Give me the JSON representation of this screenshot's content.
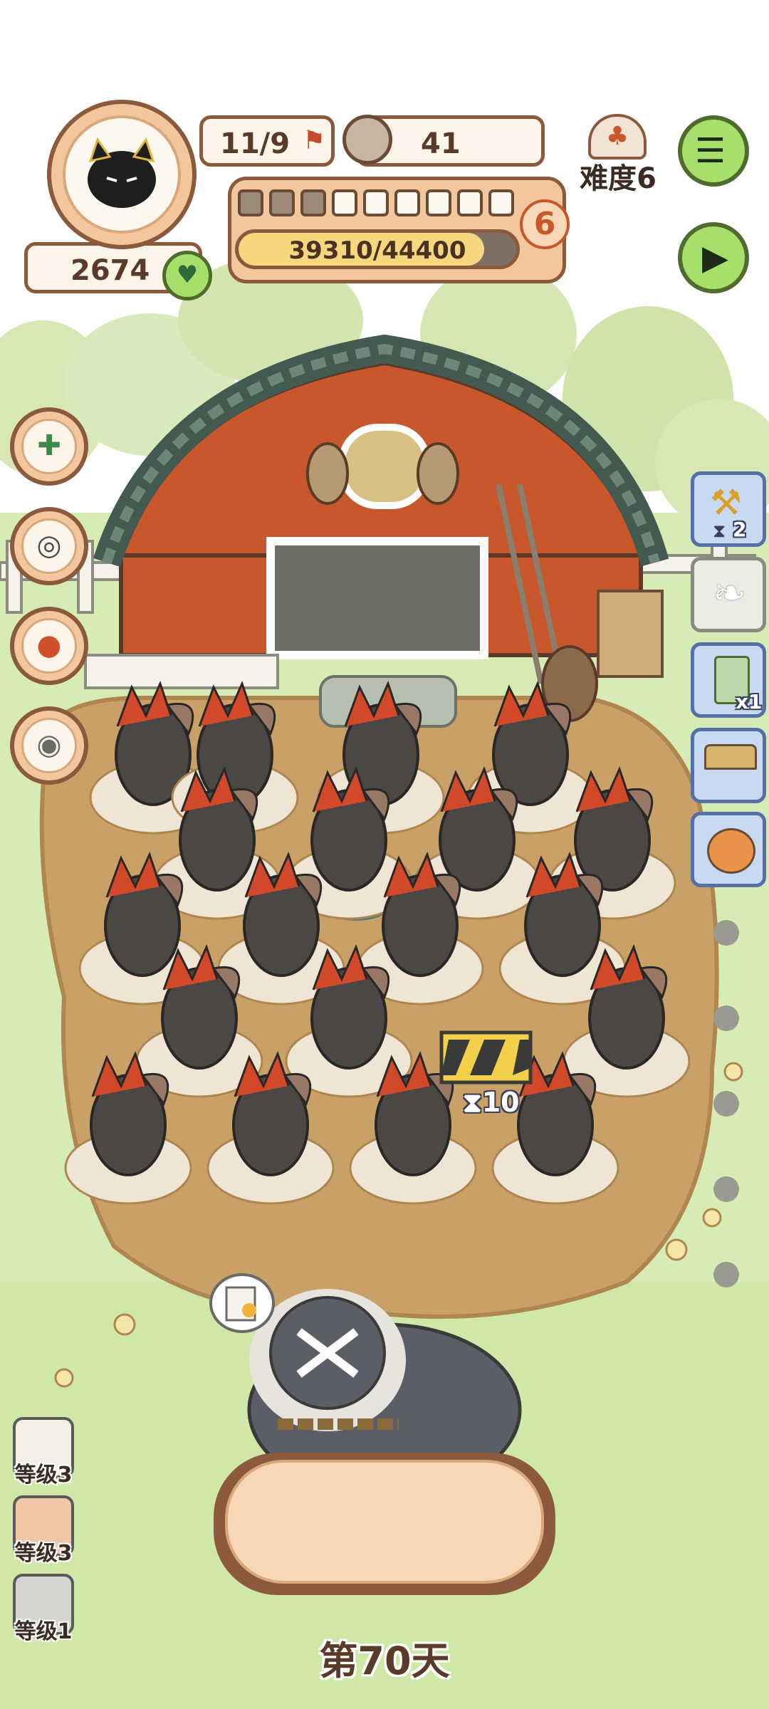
{
  "player": {
    "population": "11/9",
    "food": "41",
    "coins": "2674",
    "level": "6",
    "xp_text": "39310/44400",
    "xp_progress": 0.885,
    "segments_filled": 3,
    "segments_total": 9
  },
  "difficulty": {
    "label": "难度6"
  },
  "farm": {
    "build_timer": "10",
    "bird_count": 19
  },
  "items": [
    {
      "icon": "shovel-icon",
      "count": "2"
    },
    {
      "icon": "feather-icon",
      "count": ""
    },
    {
      "icon": "seed-packet-icon",
      "count": "x1"
    },
    {
      "icon": "straw-shelter-icon",
      "count": ""
    },
    {
      "icon": "fox-bed-icon",
      "count": ""
    }
  ],
  "side_buttons": [
    "medkit-icon",
    "collar-icon",
    "joystick-toy-icon",
    "food-bowl-icon"
  ],
  "level_cards": [
    {
      "label": "等级3"
    },
    {
      "label": "等级3"
    },
    {
      "label": "等级1"
    }
  ],
  "day_label": "第70天",
  "colors": {
    "frame_brown": "#8b5a3c",
    "panel_peach": "#f3c79e",
    "grass": "#cde8a8",
    "dirt": "#c9a066",
    "button_green": "#a6e06a",
    "slot_blue": "#c8d9f2"
  }
}
